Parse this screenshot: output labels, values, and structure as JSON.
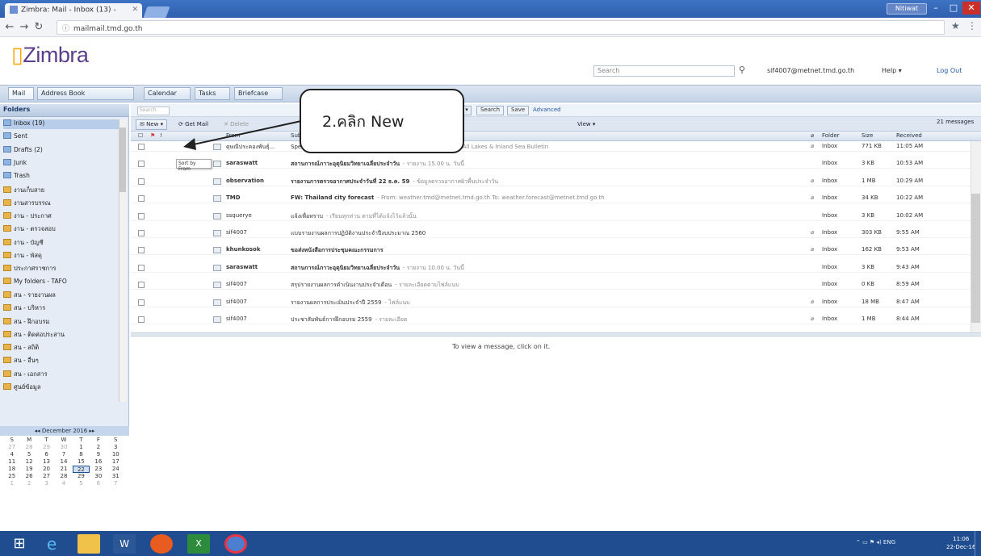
{
  "browser": {
    "tab_title": "Zimbra: Mail - Inbox (13) -",
    "url": "mailmail.tmd.go.th",
    "user_button": "Nitiwat"
  },
  "header": {
    "logo": "Zimbra",
    "search_placeholder": "Search",
    "email": "sif4007@metnet.tmd.go.th",
    "help": "Help",
    "logout": "Log Out"
  },
  "apptabs": [
    "Mail",
    "Address Book",
    "Calendar",
    "Tasks",
    "Briefcase"
  ],
  "sidebar": {
    "heading": "Folders",
    "folders": [
      {
        "label": "Inbox (19)",
        "selected": true
      },
      {
        "label": "Sent"
      },
      {
        "label": "Drafts (2)"
      },
      {
        "label": "Junk"
      },
      {
        "label": "Trash"
      },
      {
        "label": "งานเก็บสาย"
      },
      {
        "label": "งานสารบรรณ"
      },
      {
        "label": "งาน - ประกาศ"
      },
      {
        "label": "งาน - ตรวจสอบ"
      },
      {
        "label": "งาน - บัญชี"
      },
      {
        "label": "งาน - พัสดุ"
      },
      {
        "label": "ประกาศราชการ"
      },
      {
        "label": "My folders - TAFO"
      },
      {
        "label": "สน - รายงานผล"
      },
      {
        "label": "สน - บริหาร"
      },
      {
        "label": "สน - ฝึกอบรม"
      },
      {
        "label": "สน - ติดต่อประสาน"
      },
      {
        "label": "สน - สถิติ"
      },
      {
        "label": "สน - อื่นๆ"
      },
      {
        "label": "สน - เอกสาร"
      },
      {
        "label": "ศูนย์ข้อมูล"
      }
    ]
  },
  "calendar": {
    "heading": "December 2016",
    "weekdays": [
      "S",
      "M",
      "T",
      "W",
      "T",
      "F",
      "S"
    ],
    "days": [
      "27",
      "28",
      "29",
      "30",
      "1",
      "2",
      "3",
      "4",
      "5",
      "6",
      "7",
      "8",
      "9",
      "10",
      "11",
      "12",
      "13",
      "14",
      "15",
      "16",
      "17",
      "18",
      "19",
      "20",
      "21",
      "22",
      "23",
      "24",
      "25",
      "26",
      "27",
      "28",
      "29",
      "30",
      "31",
      "1",
      "2",
      "3",
      "4",
      "5",
      "6",
      "7"
    ],
    "today": "22"
  },
  "toolbar": {
    "search_input": "Search",
    "new": "New",
    "get_mail": "Get Mail",
    "delete": "Delete",
    "search_btn": "Search",
    "save": "Save",
    "advanced": "Advanced",
    "view": "View",
    "count": "21 messages"
  },
  "columns": {
    "from": "From",
    "subject": "Subject",
    "folder": "Folder",
    "size": "Size",
    "received": "Received"
  },
  "tooltip": "Sort by From",
  "messages": [
    {
      "from": "ดุษณีประคองพันธุ์...",
      "subject": "Special การประชุมผู้บริหาร",
      "snippet": "- วันที่ 15.00 น. วันที่ 22/12/2016 Fw. All Lakes & Inland Sea Bulletin",
      "attach": true,
      "folder": "Inbox",
      "size": "771 KB",
      "received": "11:05 AM",
      "unread": false
    },
    {
      "from": "saraswatt",
      "subject": "สถานการณ์ภาวะอุตุนิยมวิทยาเฉลี่ยประจำวัน",
      "snippet": "- รายงาน 15.00 น. วันนี้",
      "attach": false,
      "folder": "Inbox",
      "size": "3 KB",
      "received": "10:53 AM",
      "unread": true
    },
    {
      "from": "observation",
      "subject": "รายงานการตรวจอากาศประจำวันที่ 22 ธ.ค. 59",
      "snippet": "- ข้อมูลตรวจอากาศผิวพื้นประจำวัน",
      "attach": true,
      "folder": "Inbox",
      "size": "1 MB",
      "received": "10:29 AM",
      "unread": true
    },
    {
      "from": "TMD",
      "subject": "FW: Thailand city forecast",
      "snippet": "- From: weather.tmd@metnet.tmd.go.th To: weather.forecast@metnet.tmd.go.th",
      "attach": true,
      "folder": "Inbox",
      "size": "34 KB",
      "received": "10:22 AM",
      "unread": true
    },
    {
      "from": "ssquerye",
      "subject": "แจ้งเพื่อทราบ",
      "snippet": "- เรียนทุกท่าน ตามที่ได้แจ้งไว้แล้วนั้น",
      "attach": false,
      "folder": "Inbox",
      "size": "3 KB",
      "received": "10:02 AM",
      "unread": false
    },
    {
      "from": "sif4007",
      "subject": "แบบรายงานผลการปฏิบัติงานประจำปีงบประมาณ 2560",
      "snippet": "",
      "attach": true,
      "folder": "Inbox",
      "size": "303 KB",
      "received": "9:55 AM",
      "unread": false
    },
    {
      "from": "khunkosok",
      "subject": "ขอส่งหนังสือการประชุมคณะกรรมการ",
      "snippet": "",
      "attach": true,
      "folder": "Inbox",
      "size": "162 KB",
      "received": "9:53 AM",
      "unread": true
    },
    {
      "from": "saraswatt",
      "subject": "สถานการณ์ภาวะอุตุนิยมวิทยาเฉลี่ยประจำวัน",
      "snippet": "- รายงาน 10.00 น. วันนี้",
      "attach": false,
      "folder": "Inbox",
      "size": "3 KB",
      "received": "9:43 AM",
      "unread": true
    },
    {
      "from": "sif4007",
      "subject": "สรุปรายงานผลการดำเนินงานประจำเดือน",
      "snippet": "- รายละเอียดตามไฟล์แนบ",
      "attach": false,
      "folder": "Inbox",
      "size": "0 KB",
      "received": "8:59 AM",
      "unread": false
    },
    {
      "from": "sif4007",
      "subject": "รายงานผลการประเมินประจำปี 2559",
      "snippet": "- ไฟล์แนบ",
      "attach": true,
      "folder": "Inbox",
      "size": "18 MB",
      "received": "8:47 AM",
      "unread": false
    },
    {
      "from": "sif4007",
      "subject": "ประชาสัมพันธ์การฝึกอบรม 2559",
      "snippet": "- รายละเอียด",
      "attach": true,
      "folder": "Inbox",
      "size": "1 MB",
      "received": "8:44 AM",
      "unread": false
    }
  ],
  "reading_pane": "To view a message, click on it.",
  "callout": "2.คลิก  New",
  "taskbar": {
    "clock_time": "11:06",
    "clock_date": "22-Dec-16",
    "lang": "ENG"
  }
}
